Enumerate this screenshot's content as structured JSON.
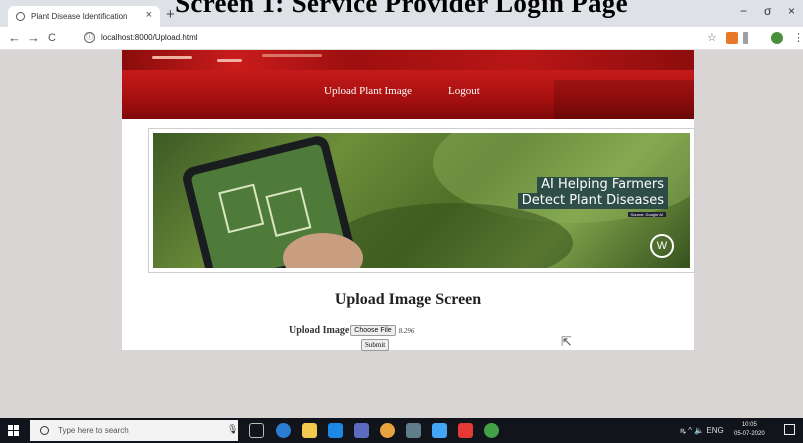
{
  "caption": "Screen 1: Service Provider Login Page",
  "browser": {
    "tab_title": "Plant Disease Identification",
    "tab_close": "×",
    "new_tab": "+",
    "back": "←",
    "forward": "→",
    "reload": "C",
    "info": "ⓘ",
    "url": "localhost:8000/Upload.html",
    "star": "☆",
    "minimize": "−",
    "maximize": "σ",
    "close": "×",
    "menu": "⋮"
  },
  "site": {
    "nav": {
      "upload_label": "Upload Plant Image",
      "logout_label": "Logout"
    },
    "hero": {
      "line1": "AI Helping Farmers",
      "line2": "Detect Plant Diseases",
      "sub": "Source: Google AI",
      "logo": "W"
    },
    "screen_title": "Upload Image Screen",
    "form": {
      "label": "Upload Image",
      "choose_label": "Choose File",
      "file_name": "8.296",
      "submit_label": "Submit"
    }
  },
  "taskbar": {
    "search_placeholder": "Type here to search",
    "time": "10:05",
    "date": "05-07-2020",
    "tray_text": "ꝶ ^ 🔈 ENG"
  },
  "colors": {
    "nav_red": "#b51414",
    "page_bg": "#d9d5d4",
    "taskbar": "#11141a"
  }
}
